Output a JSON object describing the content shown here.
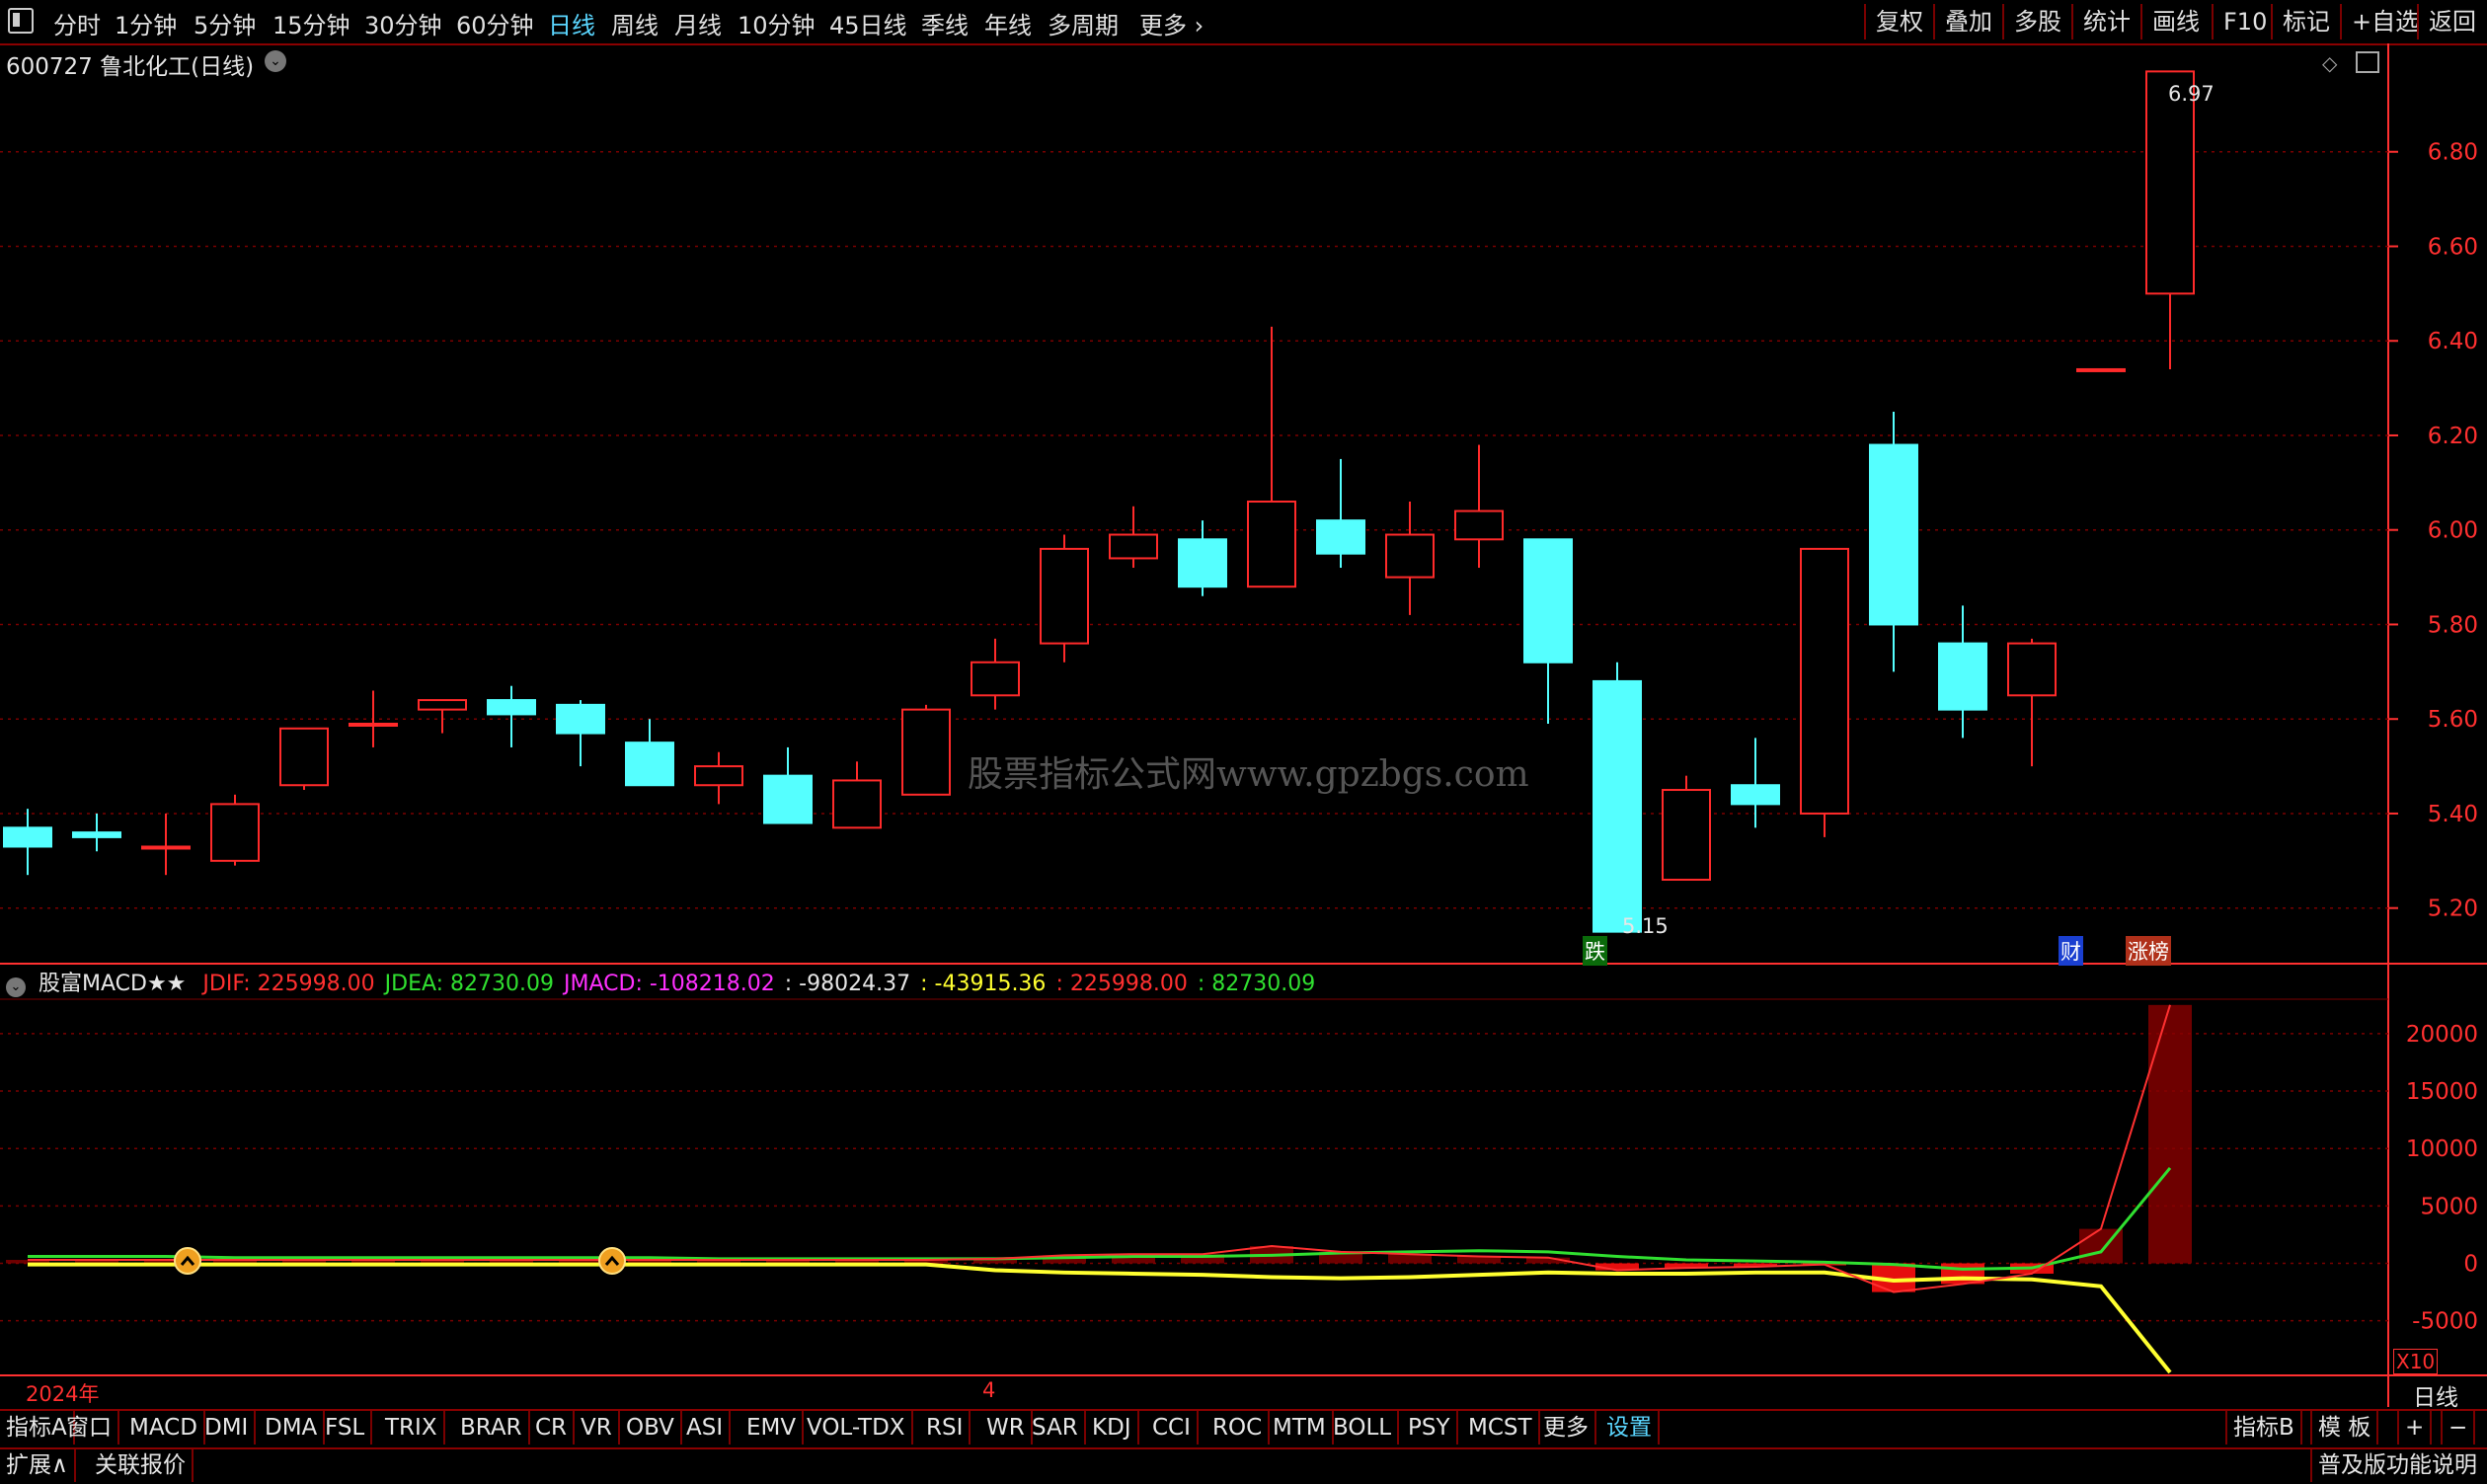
{
  "toolbar": {
    "periods": [
      "分时",
      "1分钟",
      "5分钟",
      "15分钟",
      "30分钟",
      "60分钟",
      "日线",
      "周线",
      "月线",
      "10分钟",
      "45日线",
      "季线",
      "年线",
      "多周期",
      "更多 ›"
    ],
    "active_period": "日线",
    "right_buttons": [
      "复权",
      "叠加",
      "多股",
      "统计",
      "画线",
      "F10",
      "标记",
      "+自选",
      "返回"
    ]
  },
  "chart_title": "600727 鲁北化工(日线)",
  "watermark": "股票指标公式网www.gpzbgs.com",
  "colors": {
    "up": "#ff2a2a",
    "down": "#55ffff",
    "grid": "#7a0000",
    "axis": "#ff3030",
    "bg": "#000000"
  },
  "price_axis": [
    "6.80",
    "6.60",
    "6.40",
    "6.20",
    "6.00",
    "5.80",
    "5.60",
    "5.40",
    "5.20"
  ],
  "high_marker": "6.97",
  "low_marker": "5.15",
  "badges": {
    "fall": "跌",
    "finance": "财",
    "limit": "涨榜"
  },
  "indicator": {
    "name": "股富MACD★★",
    "values": [
      {
        "label": "JDIF: 225998.00",
        "color": "#ff3030"
      },
      {
        "label": "JDEA: 82730.09",
        "color": "#30e030"
      },
      {
        "label": "JMACD: -108218.02",
        "color": "#ff30ff"
      },
      {
        "label": ": -98024.37",
        "color": "#e6e6e6"
      },
      {
        "label": ": -43915.36",
        "color": "#ffff30"
      },
      {
        "label": ": 225998.00",
        "color": "#ff3030"
      },
      {
        "label": ": 82730.09",
        "color": "#30e030"
      }
    ],
    "axis": [
      "20000",
      "15000",
      "10000",
      "5000",
      "0",
      "-5000"
    ],
    "scale_mark": "X10"
  },
  "date_axis": {
    "start": "2024年",
    "month": "4",
    "period_label": "日线"
  },
  "chart_data": {
    "type": "candlestick",
    "title": "600727 鲁北化工(日线)",
    "ylim": [
      5.12,
      7.0
    ],
    "candles": [
      {
        "o": 5.37,
        "h": 5.41,
        "l": 5.27,
        "c": 5.33
      },
      {
        "o": 5.36,
        "h": 5.4,
        "l": 5.32,
        "c": 5.35
      },
      {
        "o": 5.33,
        "h": 5.4,
        "l": 5.27,
        "c": 5.33
      },
      {
        "o": 5.3,
        "h": 5.44,
        "l": 5.29,
        "c": 5.42
      },
      {
        "o": 5.46,
        "h": 5.58,
        "l": 5.45,
        "c": 5.58
      },
      {
        "o": 5.59,
        "h": 5.66,
        "l": 5.54,
        "c": 5.59
      },
      {
        "o": 5.62,
        "h": 5.64,
        "l": 5.57,
        "c": 5.64
      },
      {
        "o": 5.64,
        "h": 5.67,
        "l": 5.54,
        "c": 5.61
      },
      {
        "o": 5.63,
        "h": 5.64,
        "l": 5.5,
        "c": 5.57
      },
      {
        "o": 5.55,
        "h": 5.6,
        "l": 5.46,
        "c": 5.46
      },
      {
        "o": 5.46,
        "h": 5.53,
        "l": 5.42,
        "c": 5.5
      },
      {
        "o": 5.48,
        "h": 5.54,
        "l": 5.38,
        "c": 5.38
      },
      {
        "o": 5.37,
        "h": 5.51,
        "l": 5.37,
        "c": 5.47
      },
      {
        "o": 5.44,
        "h": 5.63,
        "l": 5.44,
        "c": 5.62
      },
      {
        "o": 5.65,
        "h": 5.77,
        "l": 5.62,
        "c": 5.72
      },
      {
        "o": 5.76,
        "h": 5.99,
        "l": 5.72,
        "c": 5.96
      },
      {
        "o": 5.94,
        "h": 6.05,
        "l": 5.92,
        "c": 5.99
      },
      {
        "o": 5.98,
        "h": 6.02,
        "l": 5.86,
        "c": 5.88
      },
      {
        "o": 5.88,
        "h": 6.43,
        "l": 5.88,
        "c": 6.06
      },
      {
        "o": 6.02,
        "h": 6.15,
        "l": 5.92,
        "c": 5.95
      },
      {
        "o": 5.9,
        "h": 6.06,
        "l": 5.82,
        "c": 5.99
      },
      {
        "o": 5.98,
        "h": 6.18,
        "l": 5.92,
        "c": 6.04
      },
      {
        "o": 5.98,
        "h": 5.98,
        "l": 5.59,
        "c": 5.72
      },
      {
        "o": 5.68,
        "h": 5.72,
        "l": 5.15,
        "c": 5.15
      },
      {
        "o": 5.26,
        "h": 5.48,
        "l": 5.26,
        "c": 5.45
      },
      {
        "o": 5.46,
        "h": 5.56,
        "l": 5.37,
        "c": 5.42
      },
      {
        "o": 5.4,
        "h": 5.96,
        "l": 5.35,
        "c": 5.96
      },
      {
        "o": 6.18,
        "h": 6.25,
        "l": 5.7,
        "c": 5.8
      },
      {
        "o": 5.76,
        "h": 5.84,
        "l": 5.56,
        "c": 5.62
      },
      {
        "o": 5.65,
        "h": 5.77,
        "l": 5.5,
        "c": 5.76
      },
      {
        "o": 6.34,
        "h": 6.34,
        "l": 6.34,
        "c": 6.34
      },
      {
        "o": 6.5,
        "h": 6.97,
        "l": 6.34,
        "c": 6.97
      }
    ],
    "macd_ylim": [
      -9500,
      23000
    ],
    "macd_lines": {
      "dif": [
        300,
        300,
        300,
        300,
        300,
        300,
        300,
        300,
        300,
        300,
        300,
        300,
        300,
        300,
        400,
        700,
        800,
        800,
        1500,
        1000,
        800,
        600,
        500,
        -600,
        -400,
        -300,
        -100,
        -2500,
        -1800,
        -900,
        3000,
        22500
      ],
      "dea": [
        600,
        600,
        600,
        500,
        500,
        500,
        500,
        500,
        500,
        500,
        400,
        400,
        400,
        400,
        400,
        500,
        600,
        600,
        700,
        900,
        1000,
        1100,
        1000,
        600,
        300,
        200,
        100,
        -100,
        -500,
        -400,
        1000,
        8300
      ],
      "yellow": [
        -100,
        -100,
        -100,
        -100,
        -100,
        -100,
        -100,
        -100,
        -100,
        -100,
        -100,
        -100,
        -100,
        -100,
        -600,
        -800,
        -900,
        -1000,
        -1200,
        -1300,
        -1200,
        -1000,
        -800,
        -900,
        -900,
        -800,
        -800,
        -1500,
        -1300,
        -1400,
        -2000,
        -9500
      ]
    }
  },
  "indicator_tabs": [
    "指标A",
    "窗口",
    "MACD",
    "DMI",
    "DMA",
    "FSL",
    "TRIX",
    "BRAR",
    "CR",
    "VR",
    "OBV",
    "ASI",
    "EMV",
    "VOL-TDX",
    "RSI",
    "WR",
    "SAR",
    "KDJ",
    "CCI",
    "ROC",
    "MTM",
    "BOLL",
    "PSY",
    "MCST",
    "更多",
    "设置"
  ],
  "indicator_tabs_right": [
    "指标B",
    "模 板",
    "+",
    "−"
  ],
  "bottom_bar": [
    "扩展∧",
    "关联报价"
  ],
  "bottom_right": "普及版功能说明"
}
